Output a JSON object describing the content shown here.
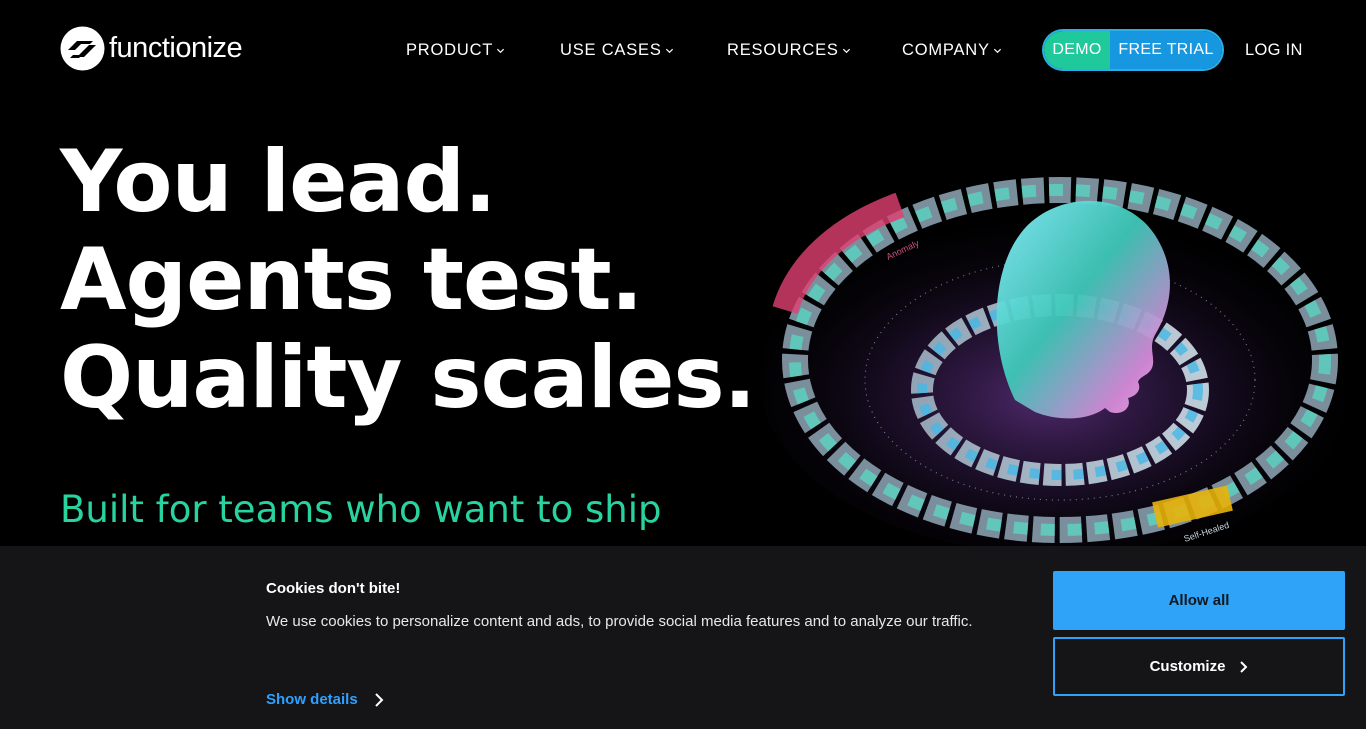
{
  "brand": {
    "name": "functionize"
  },
  "nav": {
    "items": [
      {
        "label": "PRODUCT"
      },
      {
        "label": "USE CASES"
      },
      {
        "label": "RESOURCES"
      },
      {
        "label": "COMPANY"
      }
    ],
    "demo_label": "DEMO",
    "trial_label": "FREE TRIAL",
    "login_label": "LOG IN"
  },
  "hero": {
    "lines": [
      "You lead.",
      "Agents test.",
      "Quality scales."
    ],
    "subtitle": "Built for teams who want to ship",
    "art_labels": {
      "anomaly": "Anomaly",
      "self_healed": "Self-Healed"
    }
  },
  "cookie": {
    "title": "Cookies don't bite!",
    "text": "We use cookies to personalize content and ads, to provide social media features and to analyze our traffic.",
    "show_details": "Show details",
    "allow_all": "Allow all",
    "customize": "Customize"
  },
  "colors": {
    "accent_green": "#29d3a0",
    "demo_green": "#1fc99b",
    "trial_blue": "#1797e0",
    "cookie_blue": "#2ea3f8",
    "link_blue": "#2ea0ff",
    "background": "#000000",
    "cookie_bg": "#151517"
  },
  "icons": {
    "logo": "functionize-logo-icon",
    "nav_chevron": "chevron-down-icon",
    "details_chevron": "chevron-right-icon"
  }
}
